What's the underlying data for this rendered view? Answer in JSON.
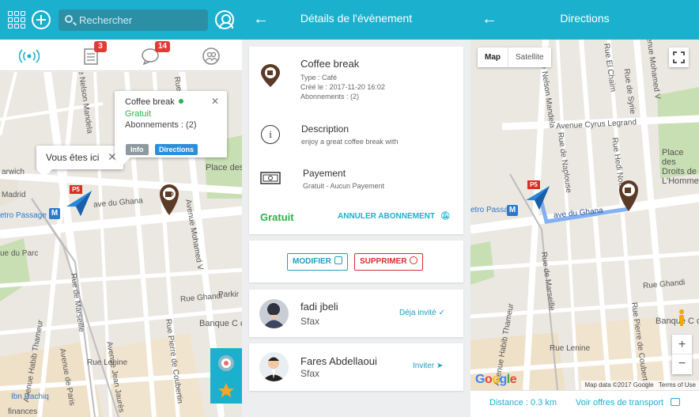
{
  "left_panel": {
    "search": {
      "placeholder": "Rechercher"
    },
    "tabs": [
      {
        "name": "nearby",
        "icon": "broadcast-icon",
        "badge": ""
      },
      {
        "name": "events",
        "icon": "list-icon",
        "badge": "3"
      },
      {
        "name": "messages",
        "icon": "chat-icon",
        "badge": "14"
      },
      {
        "name": "contacts",
        "icon": "contacts-icon",
        "badge": ""
      }
    ],
    "map": {
      "labels": [
        "Rue Nelson Mandela",
        "Rue Ibn Khaldoun",
        "Rue El Chaim",
        "Rue de Syrie",
        "Avenue Mohamed V",
        "Avenue Cyrus Legrand",
        "Rue de Naplouse",
        "Rue Hedi Nouira",
        "Place des Droits de L'Homme",
        "arwich",
        "Madrid",
        "etro Passage",
        "ave du Ghana",
        "Rue de Marseille",
        "Rue Ghandi",
        "Avenue Habib Thameur",
        "Avenue de Paris",
        "Avenue Jean Jaurès",
        "Rue Pierre de Coubertin",
        "Banque C de Tunisie",
        "Parkir",
        "Rue Lenine",
        "Ibn Rachiq",
        "finances",
        "ue du Parc"
      ],
      "metro_label": "M",
      "parking_label": "P5",
      "you_are_here": "Vous êtes ici",
      "event_popup": {
        "title": "Coffee break",
        "price": "Gratuit",
        "subs": "Abonnements : (2)",
        "info_btn": "Info",
        "directions_btn": "Directions"
      }
    }
  },
  "details_panel": {
    "title": "Détails de l'évènement",
    "event": {
      "name": "Coffee break",
      "type": "Type : Café",
      "created": "Créé le : 2017-11-20 16:02",
      "subs": "Abonnements : (2)"
    },
    "description": {
      "label": "Description",
      "text": "enjoy a great coffee break with"
    },
    "payment": {
      "label": "Payement",
      "text": "Gratuit - Aucun Payement"
    },
    "price_badge": "Gratuit",
    "cancel_label": "ANNULER ABONNEMENT",
    "modify_label": "MODIFIER",
    "delete_label": "SUPPRIMER",
    "people": [
      {
        "name": "fadi jbeli",
        "city": "Sfax",
        "action": "Déja invité"
      },
      {
        "name": "Fares Abdellaoui",
        "city": "Sfax",
        "action": "Inviter"
      }
    ]
  },
  "directions_panel": {
    "title": "Directions",
    "map_types": [
      "Map",
      "Satellite"
    ],
    "map_attribution": "Map data ©2017 Google",
    "terms": "Terms of Use",
    "google_logo": "Google",
    "distance": "Distance : 0.3 km",
    "transport_link": "Voir offres de transport"
  },
  "colors": {
    "primary": "#1cb0cf",
    "green": "#2bb24c",
    "danger": "#d32f2f",
    "badge": "#e53935",
    "popup_info": "#8e9aa0",
    "popup_directions": "#2f8ed8"
  }
}
